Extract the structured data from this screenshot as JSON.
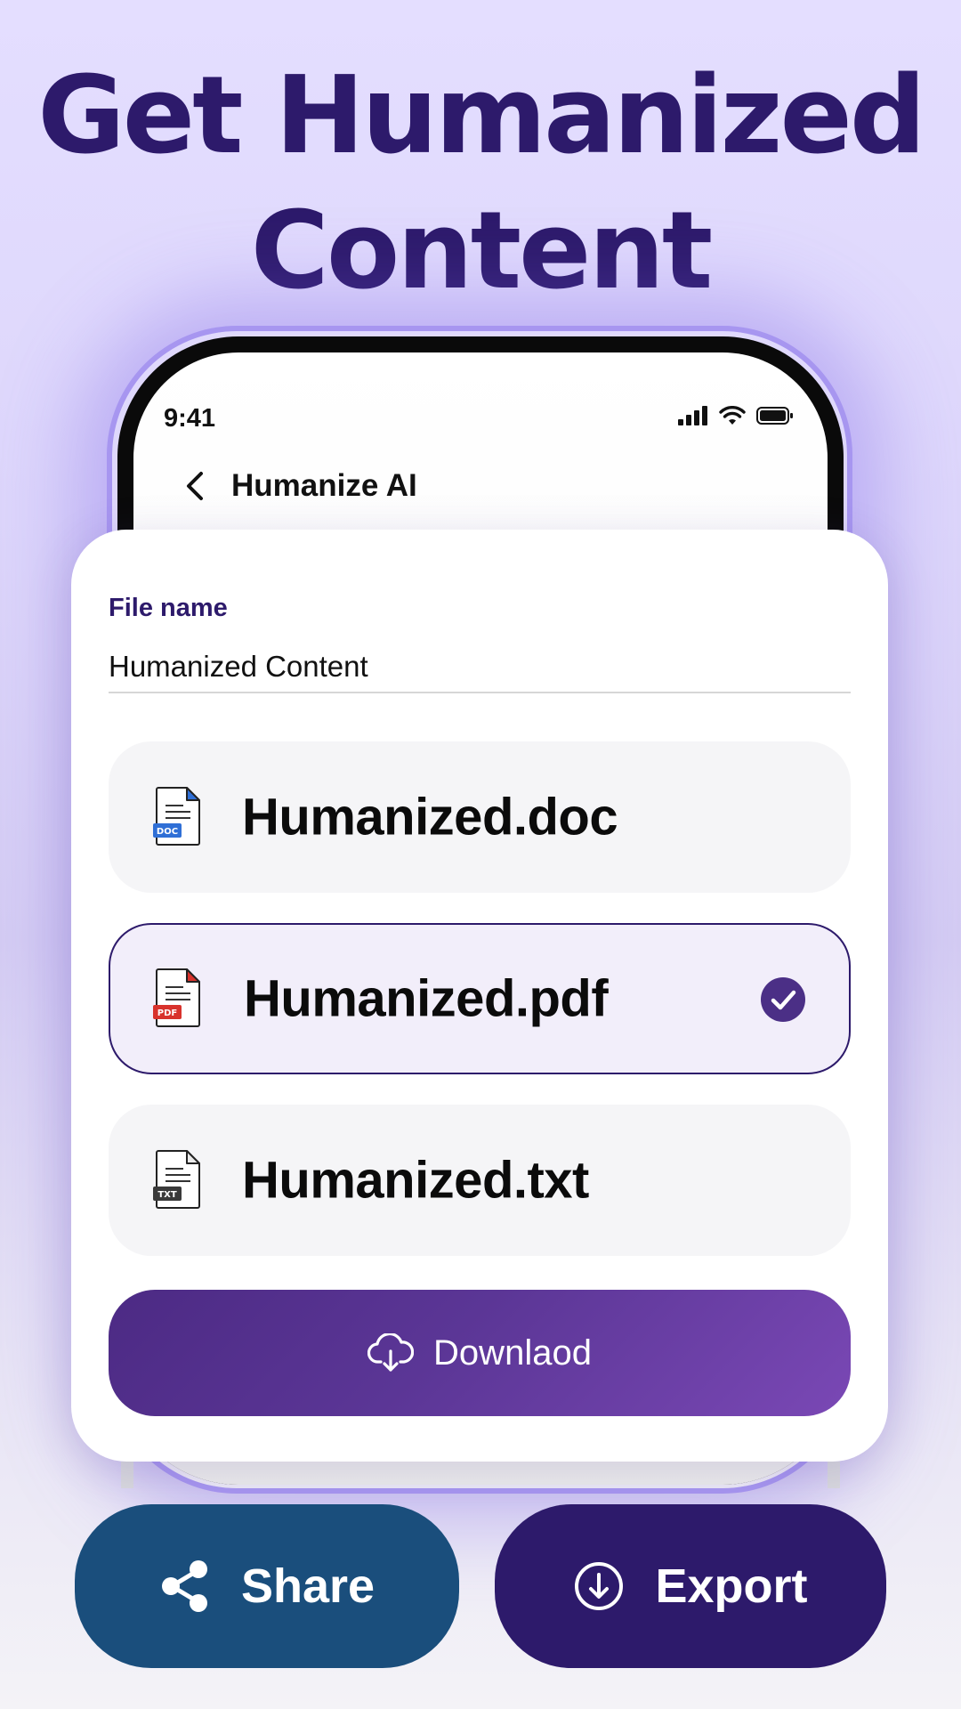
{
  "headline": {
    "line1": "Get Humanized",
    "line2": "Content"
  },
  "status_bar": {
    "time": "9:41",
    "icons": [
      "signal-icon",
      "wifi-icon",
      "battery-icon"
    ]
  },
  "nav": {
    "back_icon": "chevron-left-icon",
    "title": "Humanize AI"
  },
  "sheet": {
    "file_name_label": "File name",
    "file_name_value": "Humanized Content",
    "options": [
      {
        "label": "Humanized.doc",
        "icon": "doc-file-icon",
        "badge": "DOC",
        "badge_color": "#2f6fd6",
        "selected": false
      },
      {
        "label": "Humanized.pdf",
        "icon": "pdf-file-icon",
        "badge": "PDF",
        "badge_color": "#d8322c",
        "selected": true
      },
      {
        "label": "Humanized.txt",
        "icon": "txt-file-icon",
        "badge": "TXT",
        "badge_color": "#3a3a3a",
        "selected": false
      }
    ],
    "download_label": "Downlaod",
    "download_icon": "cloud-download-icon"
  },
  "actions": {
    "share_label": "Share",
    "share_icon": "share-icon",
    "export_label": "Export",
    "export_icon": "download-circle-icon"
  },
  "colors": {
    "brand_dark": "#2d1a6b",
    "share_blue": "#1a4e7c",
    "download_gradient": [
      "#4c2a84",
      "#7a48b5"
    ],
    "selected_check": "#4b2f86"
  }
}
